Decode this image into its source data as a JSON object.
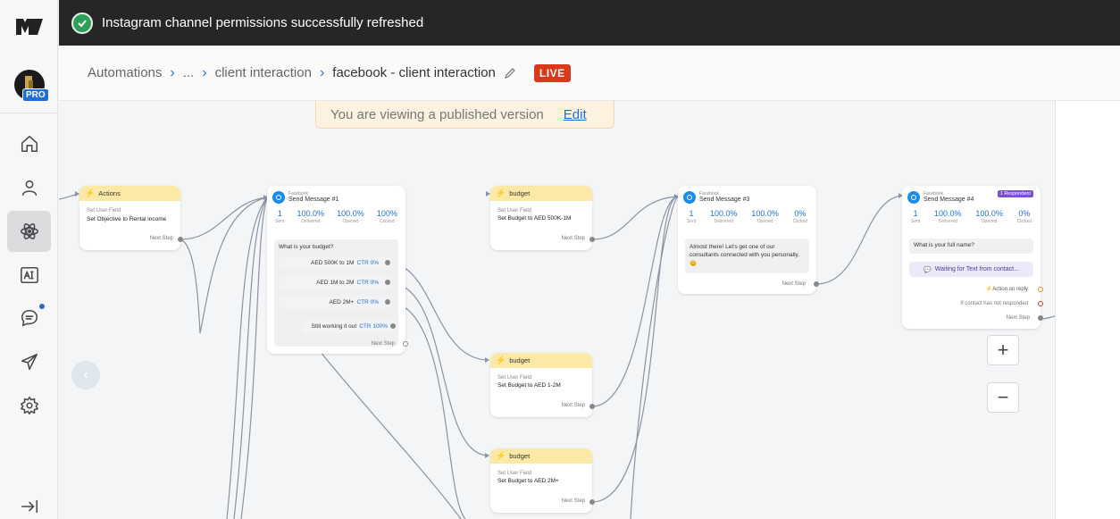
{
  "toast": {
    "message": "Instagram channel permissions successfully refreshed"
  },
  "breadcrumb": {
    "items": [
      "Automations",
      "...",
      "client interaction",
      "facebook - client interaction"
    ],
    "status": "LIVE"
  },
  "account": {
    "badge": "PRO"
  },
  "banner": {
    "text": "You are viewing a published version",
    "link": "Edit"
  },
  "nodes": {
    "actions": {
      "title": "Actions",
      "field_label": "Set User Field",
      "field_value": "Set Objective to Rental income",
      "next": "Next Step"
    },
    "msg1": {
      "source": "Facebook",
      "name": "Send Message #1",
      "stats": [
        [
          "1",
          "Sent"
        ],
        [
          "100.0%",
          "Delivered"
        ],
        [
          "100.0%",
          "Opened"
        ],
        [
          "100%",
          "Clicked"
        ]
      ],
      "question": "What is your budget?",
      "buttons": [
        {
          "label": "AED 500K to 1M",
          "ctr": "CTR 0%"
        },
        {
          "label": "AED 1M to 2M",
          "ctr": "CTR 0%"
        },
        {
          "label": "AED 2M+",
          "ctr": "CTR 0%"
        },
        {
          "label": "Still working it out",
          "ctr": "CTR 100%"
        }
      ],
      "next": "Next Step"
    },
    "budget1": {
      "title": "budget",
      "field_label": "Set User Field",
      "field_value": "Set Budget to AED 500K-1M",
      "next": "Next Step"
    },
    "budget2": {
      "title": "budget",
      "field_label": "Set User Field",
      "field_value": "Set Budget to AED 1-2M",
      "next": "Next Step"
    },
    "budget3": {
      "title": "budget",
      "field_label": "Set User Field",
      "field_value": "Set Budget to AED 2M+",
      "next": "Next Step"
    },
    "msg3": {
      "source": "Facebook",
      "name": "Send Message #3",
      "stats": [
        [
          "1",
          "Sent"
        ],
        [
          "100.0%",
          "Delivered"
        ],
        [
          "100.0%",
          "Opened"
        ],
        [
          "0%",
          "Clicked"
        ]
      ],
      "text": "Almost there! Let's get one of our consultants connected with you personally. 😊",
      "next": "Next Step"
    },
    "msg4": {
      "source": "Facebook",
      "name": "Send Message #4",
      "badge": "1 Respondent",
      "stats": [
        [
          "1",
          "Sent"
        ],
        [
          "100.0%",
          "Delivered"
        ],
        [
          "100.0%",
          "Opened"
        ],
        [
          "0%",
          "Clicked"
        ]
      ],
      "text": "What is your full name?",
      "waiting": "Waiting for Text from contact...",
      "on_reply": "Action on reply",
      "no_response": "If contact has not responded",
      "next": "Next Step"
    }
  },
  "zoom": {
    "in": "+",
    "out": "−"
  },
  "colors": {
    "accent": "#1f6fd6",
    "live": "#d93a1c",
    "action_header": "#fde9a6",
    "toast_bg": "#262626"
  }
}
